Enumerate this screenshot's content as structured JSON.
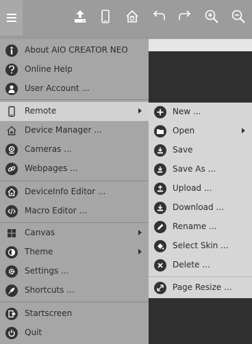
{
  "toolbar": {
    "icons": [
      "menu-icon",
      "upload-icon",
      "phone-icon",
      "device-home-icon",
      "undo-icon",
      "redo-icon",
      "zoom-in-icon",
      "zoom-out-icon"
    ]
  },
  "main_menu": {
    "items": [
      {
        "label": "About AIO CREATOR NEO",
        "icon": "info-icon"
      },
      {
        "label": "Online Help",
        "icon": "help-icon"
      },
      {
        "label": "User Account ...",
        "icon": "user-icon"
      },
      {
        "label": "Remote",
        "icon": "phone-icon",
        "submenu": true,
        "active": true
      },
      {
        "label": "Device Manager ...",
        "icon": "device-home-icon"
      },
      {
        "label": "Cameras ...",
        "icon": "camera-icon"
      },
      {
        "label": "Webpages ...",
        "icon": "link-icon"
      },
      {
        "label": "DeviceInfo Editor ...",
        "icon": "device-home-icon"
      },
      {
        "label": "Macro Editor ...",
        "icon": "code-icon"
      },
      {
        "label": "Canvas",
        "icon": "grid-icon",
        "submenu": true
      },
      {
        "label": "Theme",
        "icon": "contrast-icon",
        "submenu": true
      },
      {
        "label": "Settings ...",
        "icon": "gear-icon"
      },
      {
        "label": "Shortcuts ...",
        "icon": "rocket-icon"
      },
      {
        "label": "Startscreen",
        "icon": "startscreen-icon"
      },
      {
        "label": "Quit",
        "icon": "power-icon"
      }
    ]
  },
  "remote_submenu": {
    "items": [
      {
        "label": "New ...",
        "icon": "plus-icon"
      },
      {
        "label": "Open",
        "icon": "folder-icon",
        "submenu": true
      },
      {
        "label": "Save",
        "icon": "save-icon"
      },
      {
        "label": "Save As ...",
        "icon": "save-as-icon"
      },
      {
        "label": "Upload ...",
        "icon": "upload-icon"
      },
      {
        "label": "Download ...",
        "icon": "download-icon"
      },
      {
        "label": "Rename ...",
        "icon": "pencil-icon"
      },
      {
        "label": "Select Skin ...",
        "icon": "paint-bucket-icon"
      },
      {
        "label": "Delete ...",
        "icon": "delete-icon"
      },
      {
        "label": "Page Resize ...",
        "icon": "resize-icon"
      }
    ]
  },
  "colors": {
    "toolbar_bg": "#9c9c9c",
    "menu_bg": "#a6a6a6",
    "submenu_bg": "#d6d6d6",
    "active_item": "#d2d2d2",
    "canvas_dark": "#2f2f2f"
  }
}
